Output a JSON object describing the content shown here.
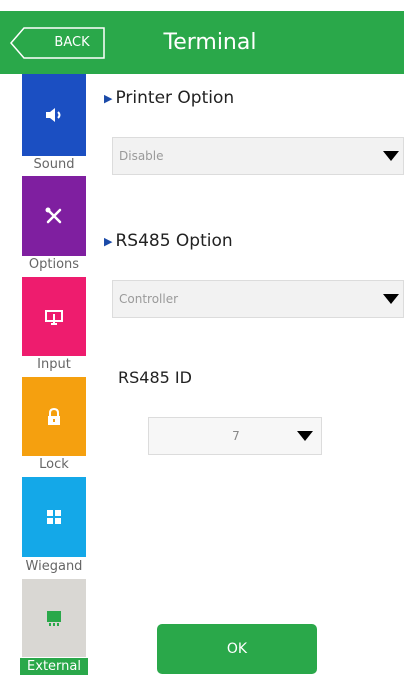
{
  "header": {
    "back_label": "BACK",
    "title": "Terminal",
    "color": "#2aa84a"
  },
  "sidebar": {
    "items": [
      {
        "label": "Sound",
        "icon": "speaker-icon",
        "color": "#1b4fc2"
      },
      {
        "label": "Options",
        "icon": "tools-icon",
        "color": "#7f1fa0"
      },
      {
        "label": "Input",
        "icon": "display-icon",
        "color": "#ee1c6e"
      },
      {
        "label": "Lock",
        "icon": "lock-icon",
        "color": "#f5a00f"
      },
      {
        "label": "Wiegand",
        "icon": "grid-icon",
        "color": "#14a8e8"
      },
      {
        "label": "External",
        "icon": "module-icon",
        "color": "#d9d7d3",
        "active": true
      }
    ]
  },
  "printer_option": {
    "heading": "Printer Option",
    "value": "Disable"
  },
  "rs485_option": {
    "heading": "RS485 Option",
    "value": "Controller"
  },
  "rs485_id": {
    "label": "RS485 ID",
    "value": "7"
  },
  "ok_button": {
    "label": "OK"
  }
}
